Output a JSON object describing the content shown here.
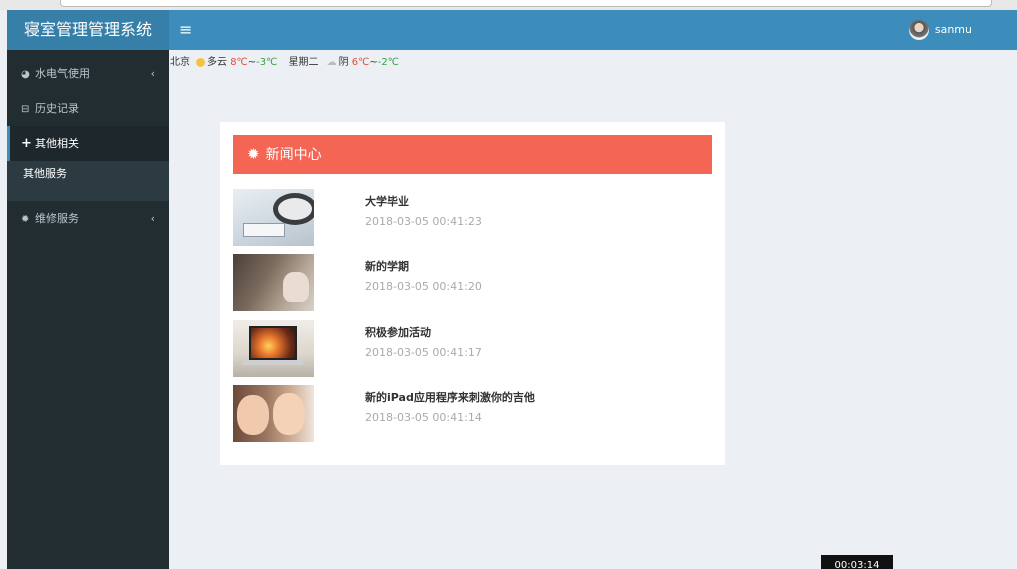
{
  "app": {
    "title": "寝室管理管理系统",
    "menu_toggle": "≡",
    "username": "sanmu"
  },
  "sidebar": {
    "items": [
      {
        "label": "水电气使用",
        "icon": "chart-icon",
        "chevron": "‹"
      },
      {
        "label": "历史记录",
        "icon": "inbox-icon"
      },
      {
        "label": "其他相关",
        "icon": "plus-icon"
      },
      {
        "label": "维修服务",
        "icon": "gear-icon",
        "chevron": "‹"
      }
    ],
    "subitem": "其他服务"
  },
  "weather": {
    "city": "北京",
    "today_desc": "多云",
    "today_high": "8℃",
    "today_sep": "~",
    "today_low": "-3℃",
    "weekday": "星期二",
    "tomorrow_desc": "阴",
    "tomorrow_high": "6℃",
    "tomorrow_sep": "~",
    "tomorrow_low": "-2℃"
  },
  "news": {
    "header": "新闻中心",
    "items": [
      {
        "title": "大学毕业",
        "date": "2018-03-05 00:41:23"
      },
      {
        "title": "新的学期",
        "date": "2018-03-05 00:41:20"
      },
      {
        "title": "积极参加活动",
        "date": "2018-03-05 00:41:17"
      },
      {
        "title": "新的iPad应用程序来刺激你的吉他",
        "date": "2018-03-05 00:41:14"
      }
    ]
  },
  "video_time": "00:03:14",
  "colors": {
    "logo_bg": "#367fa9",
    "navbar_bg": "#3c8dbc",
    "sidebar_bg": "#222d32",
    "news_header_bg": "#f56554"
  }
}
